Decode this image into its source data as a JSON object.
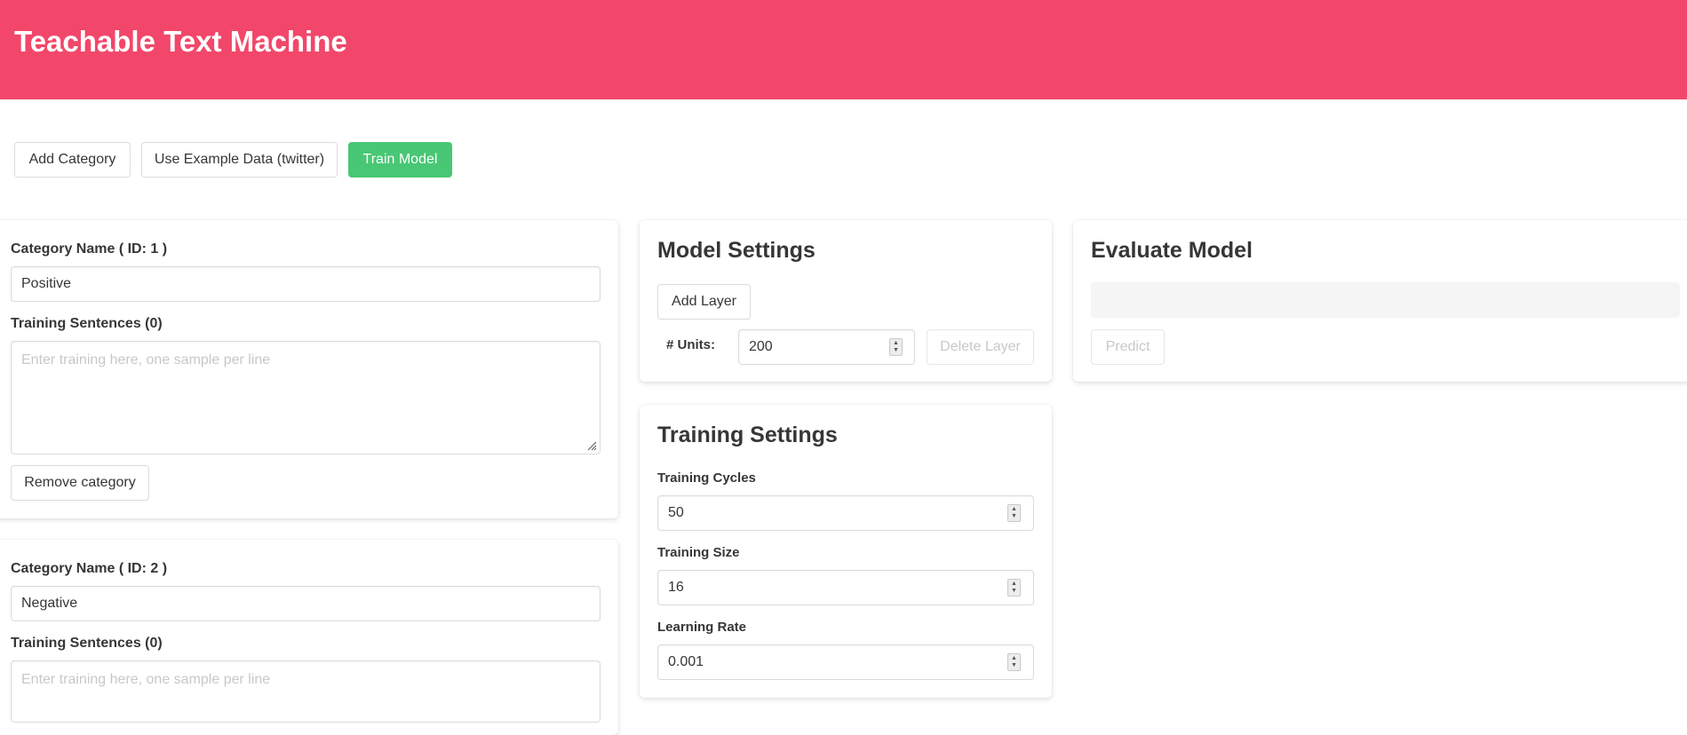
{
  "app": {
    "title": "Teachable Text Machine"
  },
  "toolbar": {
    "add_category": "Add Category",
    "use_example": "Use Example Data (twitter)",
    "train_model": "Train Model"
  },
  "categories": [
    {
      "name_label": "Category Name ( ID: 1 )",
      "name_value": "Positive",
      "sentences_label": "Training Sentences (0)",
      "sentences_placeholder": "Enter training here, one sample per line",
      "remove_label": "Remove category"
    },
    {
      "name_label": "Category Name ( ID: 2 )",
      "name_value": "Negative",
      "sentences_label": "Training Sentences (0)",
      "sentences_placeholder": "Enter training here, one sample per line"
    }
  ],
  "model_settings": {
    "title": "Model Settings",
    "add_layer": "Add Layer",
    "units_label": "# Units:",
    "units_value": "200",
    "delete_layer": "Delete Layer"
  },
  "training_settings": {
    "title": "Training Settings",
    "cycles_label": "Training Cycles",
    "cycles_value": "50",
    "size_label": "Training Size",
    "size_value": "16",
    "rate_label": "Learning Rate",
    "rate_value": "0.001"
  },
  "evaluate": {
    "title": "Evaluate Model",
    "input_value": "",
    "predict": "Predict"
  },
  "colors": {
    "header": "#f2476a",
    "success": "#48c774"
  }
}
